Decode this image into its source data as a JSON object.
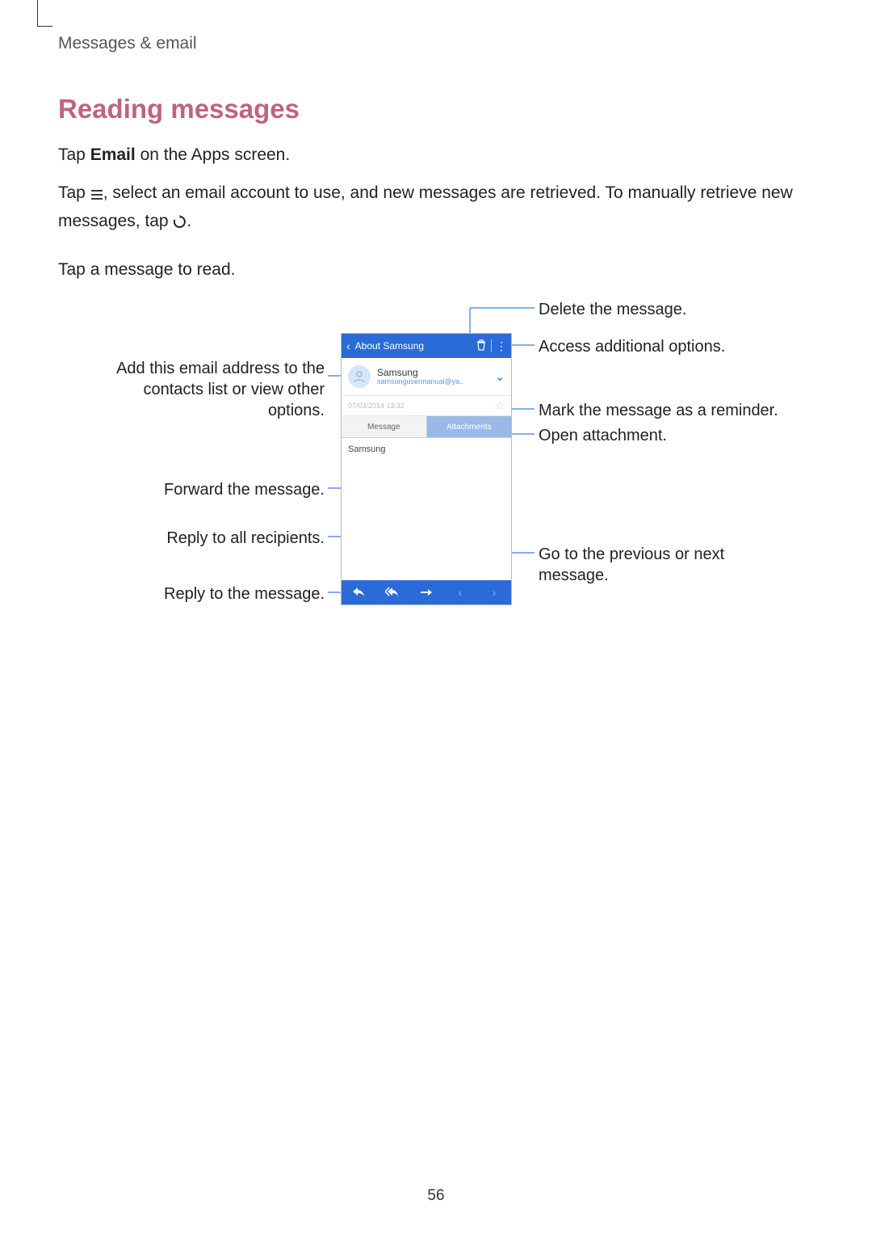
{
  "breadcrumb": "Messages & email",
  "heading": "Reading messages",
  "para1_pre": "Tap ",
  "para1_bold": "Email",
  "para1_post": " on the Apps screen.",
  "para2_pre": "Tap ",
  "para2_mid": ", select an email account to use, and new messages are retrieved. To manually retrieve new messages, tap ",
  "para2_post": ".",
  "para3": "Tap a message to read.",
  "callouts": {
    "delete": "Delete the message.",
    "options": "Access additional options.",
    "add_contact": "Add this email address to the contacts list or view other options.",
    "reminder": "Mark the message as a reminder.",
    "attachment": "Open attachment.",
    "forward": "Forward the message.",
    "reply_all": "Reply to all recipients.",
    "reply": "Reply to the message.",
    "prev_next": "Go to the previous or next message."
  },
  "phone": {
    "back_title": "About Samsung",
    "sender": "Samsung",
    "sender_addr": "samsungusermanual@ya..",
    "date": "07/03/2014  13:32",
    "tab_msg": "Message",
    "tab_att": "Attachments",
    "body": "Samsung"
  },
  "page_number": "56"
}
